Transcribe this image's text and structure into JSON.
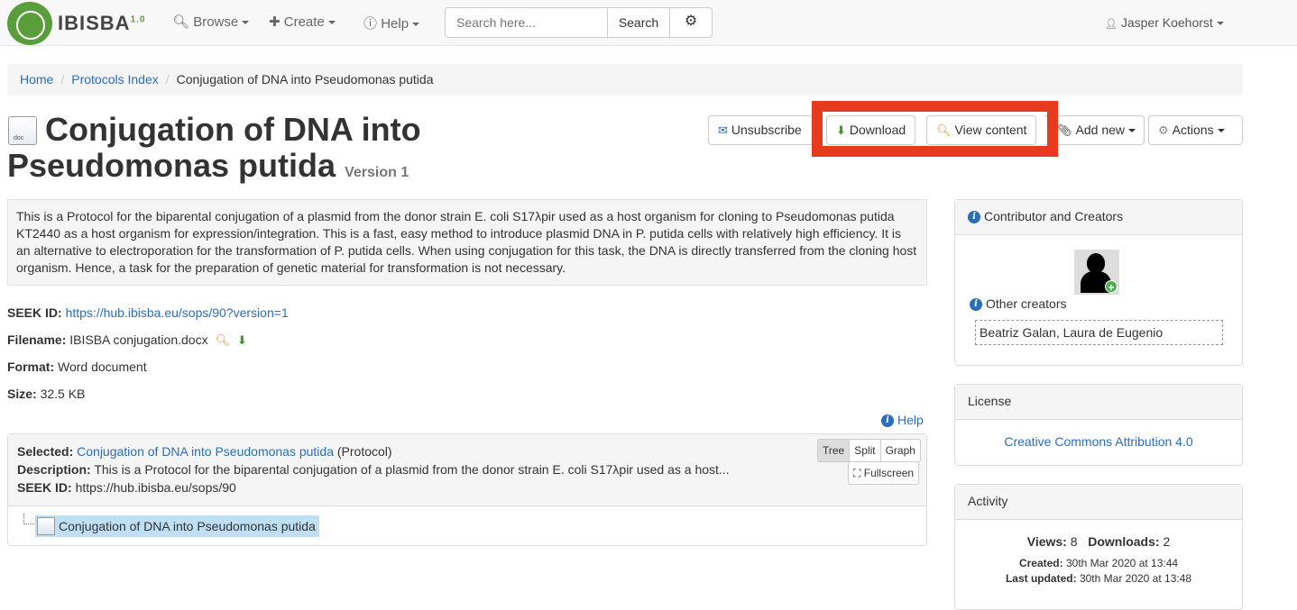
{
  "navbar": {
    "logo_text": "IBISBA",
    "logo_version": "1.0",
    "browse": "Browse",
    "create": "Create",
    "help": "Help",
    "search_placeholder": "Search here...",
    "search_button": "Search",
    "user_name": "Jasper Koehorst"
  },
  "breadcrumb": {
    "home": "Home",
    "index": "Protocols Index",
    "current": "Conjugation of DNA into Pseudomonas putida"
  },
  "page": {
    "title": "Conjugation of DNA into Pseudomonas putida",
    "version": "Version 1",
    "doc_icon_text": "doc"
  },
  "actions": {
    "unsubscribe": "Unsubscribe",
    "download": "Download",
    "view_content": "View content",
    "add_new": "Add new",
    "actions": "Actions"
  },
  "description": "This is a Protocol for the biparental conjugation of a plasmid from the donor strain E. coli S17λpir used as a host organism for cloning to Pseudomonas putida KT2440 as a host organism for expression/integration. This is a fast, easy method to introduce plasmid DNA in P. putida cells with relatively high efficiency. It is an alternative to electroporation for the transformation of P. putida cells. When using conjugation for this task, the DNA is directly transferred from the cloning host organism. Hence, a task for the preparation of genetic material for transformation is not necessary.",
  "meta": {
    "seek_id_label": "SEEK ID:",
    "seek_id_value": "https://hub.ibisba.eu/sops/90?version=1",
    "filename_label": "Filename:",
    "filename_value": "IBISBA conjugation.docx",
    "format_label": "Format:",
    "format_value": "Word document",
    "size_label": "Size:",
    "size_value": "32.5 KB"
  },
  "help_link": "Help",
  "tree": {
    "selected_label": "Selected:",
    "selected_link": "Conjugation of DNA into Pseudomonas putida",
    "selected_type": "(Protocol)",
    "description_label": "Description:",
    "description_value": "This is a Protocol for the biparental conjugation of a plasmid from the donor strain E. coli S17λpir used as a host...",
    "seek_id_label": "SEEK ID:",
    "seek_id_value": "https://hub.ibisba.eu/sops/90",
    "view_tree": "Tree",
    "view_split": "Split",
    "view_graph": "Graph",
    "fullscreen": "Fullscreen",
    "node_label": "Conjugation of DNA into Pseudomonas putida"
  },
  "contributors": {
    "heading": "Contributor and Creators",
    "other_creators_label": "Other creators",
    "other_creators_value": "Beatriz Galan, Laura de Eugenio"
  },
  "license": {
    "heading": "License",
    "value": "Creative Commons Attribution 4.0"
  },
  "activity": {
    "heading": "Activity",
    "views_label": "Views:",
    "views_value": "8",
    "downloads_label": "Downloads:",
    "downloads_value": "2",
    "created_label": "Created:",
    "created_value": "30th Mar 2020 at 13:44",
    "updated_label": "Last updated:",
    "updated_value": "30th Mar 2020 at 13:48"
  },
  "colors": {
    "link": "#2a6ebb",
    "highlight": "#e63b1f",
    "logo_green": "#5a9e3c"
  }
}
